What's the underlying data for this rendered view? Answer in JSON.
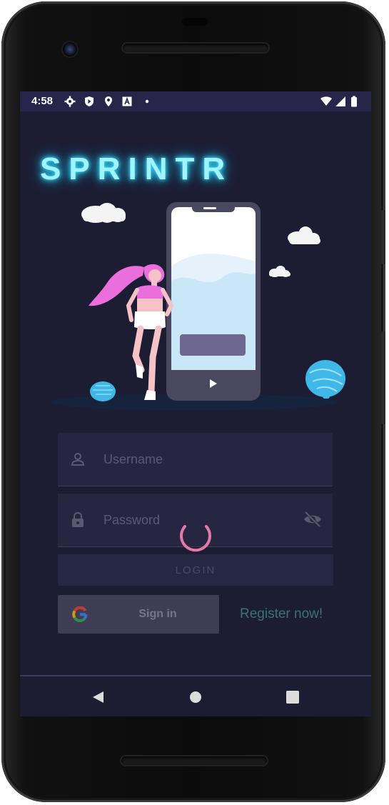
{
  "statusbar": {
    "time": "4:58",
    "left_icons": [
      "gear-icon",
      "shield-icon",
      "location-pin-icon",
      "font-a-icon",
      "dot-icon"
    ],
    "right_icons": [
      "wifi-icon",
      "signal-icon",
      "battery-icon"
    ]
  },
  "app": {
    "title": "SPRINTR",
    "title_color": "#9ff4ff"
  },
  "form": {
    "username_placeholder": "Username",
    "password_placeholder": "Password",
    "login_label": "LOGIN",
    "google_label": "Sign in",
    "register_label": "Register now!"
  },
  "navbar": {
    "buttons": [
      "back-icon",
      "home-icon",
      "recents-icon"
    ]
  },
  "colors": {
    "background": "#1c1d33",
    "status_bar": "#28254a",
    "spinner": "#e07aa8",
    "register_link": "#3b7276"
  }
}
